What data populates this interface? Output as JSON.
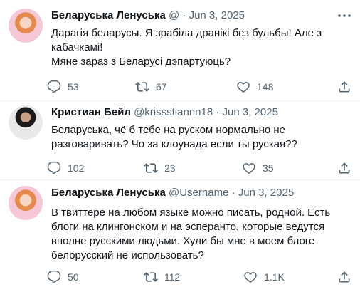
{
  "icons": {
    "more": "more-horizontal-icon",
    "reply": "reply-icon",
    "retweet": "retweet-icon",
    "like": "like-icon",
    "share": "share-icon"
  },
  "colors": {
    "text": "#0f1419",
    "muted": "#536471",
    "divider": "#eff3f4"
  },
  "tweets": [
    {
      "name": "Беларуська Ленуська",
      "handle": "@",
      "sep": "·",
      "date": "Jun 3, 2025",
      "lines": [
        "Дарагія беларусы. Я зрабіла дранікі без бульбы! Але з",
        "кабачкамі!",
        "Мяне зараз з Беларусі дэпартуюць?"
      ],
      "replies": "53",
      "retweets": "67",
      "likes": "148"
    },
    {
      "name": "Кристиан Бейл",
      "handle": "@krissstiannn18",
      "sep": "·",
      "date": "Jun 3, 2025",
      "lines": [
        "Беларуська, чё б тебе на руском нормально не",
        "разговаривать? Чо за клоунада если ты руская??"
      ],
      "replies": "102",
      "retweets": "23",
      "likes": "35"
    },
    {
      "name": "Беларуська Ленуська",
      "handle": "@Username",
      "sep": "·",
      "date": "Jun 3, 2025",
      "lines": [
        "В твиттере на любом языке можно писать, родной. Есть",
        "блоги на клингонском и на эсперанто, которые ведутся",
        "вполне русскими людьми. Хули бы мне в моем блоге",
        "белорусский не использовать?"
      ],
      "replies": "50",
      "retweets": "112",
      "likes": "1.1K"
    }
  ]
}
